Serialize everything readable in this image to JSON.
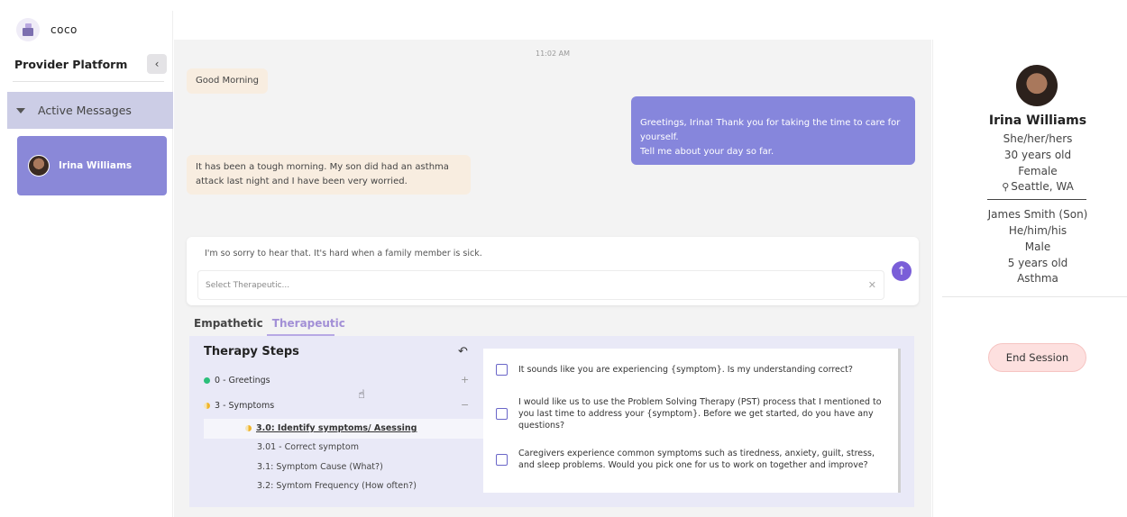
{
  "app": {
    "brand": "coco",
    "platform_title": "Provider Platform"
  },
  "sidebar": {
    "section_label": "Active Messages",
    "contacts": [
      {
        "name": "Irina Williams"
      }
    ]
  },
  "chat": {
    "timestamp": "11:02 AM",
    "messages": [
      {
        "from": "patient",
        "text": "Good Morning"
      },
      {
        "from": "provider",
        "text": "Greetings, Irina! Thank you for taking the time to care for yourself.\nTell me about your day so far."
      },
      {
        "from": "patient",
        "text": "It has been a tough morning. My son did had an asthma attack last night and I have been very worried."
      }
    ],
    "composer": {
      "draft": "I'm so sorry to hear that. It's hard when a family member is sick.",
      "select_placeholder": "Select Therapeutic..."
    }
  },
  "tabs": [
    "Empathetic",
    "Therapeutic"
  ],
  "therapy": {
    "title": "Therapy Steps",
    "steps": [
      {
        "label": "0 - Greetings",
        "sign": "+"
      },
      {
        "label": "3 - Symptoms",
        "sign": "−"
      }
    ],
    "substeps": [
      "3.0: Identify symptoms/ Asessing",
      "3.01 - Correct symptom",
      "3.1: Symptom Cause (What?)",
      "3.2: Symtom Frequency (How often?)"
    ],
    "options": [
      "It sounds like you are experiencing {symptom}. Is my understanding correct?",
      "I would like us to use the Problem Solving Therapy (PST) process that I mentioned to you last time to address your {symptom}. Before we get started, do you have any questions?",
      "Caregivers experience common symptoms such as tiredness, anxiety, guilt, stress, and sleep problems. Would you pick one for us to work on together and improve?"
    ]
  },
  "profile": {
    "name": "Irina Williams",
    "pronouns": "She/her/hers",
    "age": "30 years old",
    "gender": "Female",
    "location": "Seattle, WA",
    "dependent": {
      "name": "James Smith (Son)",
      "pronouns": "He/him/his",
      "gender": "Male",
      "age": "5 years old",
      "condition": "Asthma"
    },
    "end_button": "End Session"
  }
}
